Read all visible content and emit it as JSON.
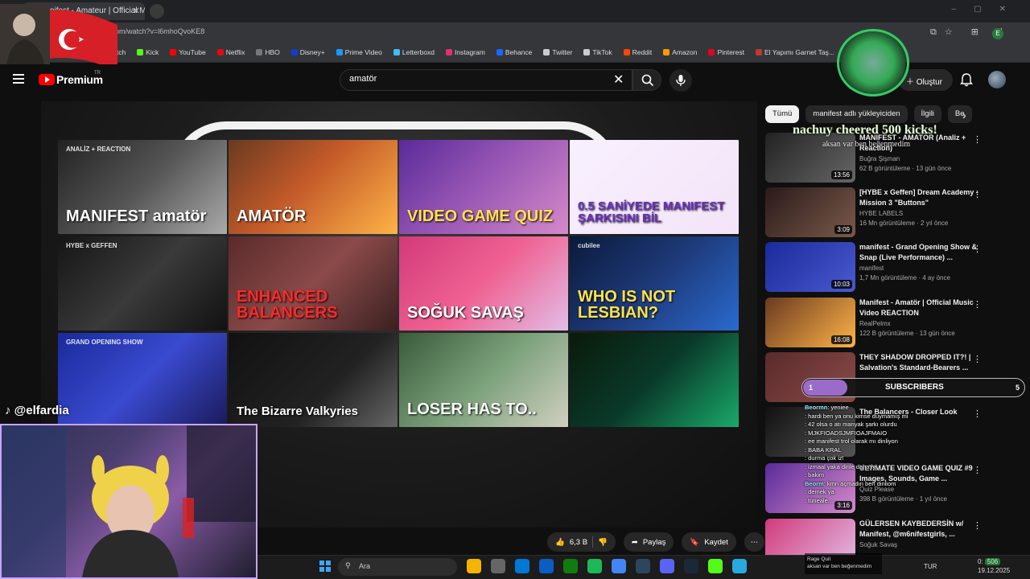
{
  "browser": {
    "tab_title": "nifest - Amateur | Official Mu",
    "url": ".com/watch?v=l6mhoQvoKE8",
    "bookmarks": [
      {
        "label": "itch",
        "color": "#9146ff"
      },
      {
        "label": "Kick",
        "color": "#53fc18"
      },
      {
        "label": "YouTube",
        "color": "#ff0000"
      },
      {
        "label": "Netflix",
        "color": "#e50914"
      },
      {
        "label": "HBO",
        "color": "#777777"
      },
      {
        "label": "Disney+",
        "color": "#113ccf"
      },
      {
        "label": "Prime Video",
        "color": "#1a98ff"
      },
      {
        "label": "Letterboxd",
        "color": "#40bcf4"
      },
      {
        "label": "Instagram",
        "color": "#e1306c"
      },
      {
        "label": "Behance",
        "color": "#1769ff"
      },
      {
        "label": "Twitter",
        "color": "#cccccc"
      },
      {
        "label": "TikTok",
        "color": "#cccccc"
      },
      {
        "label": "Reddit",
        "color": "#ff4500"
      },
      {
        "label": "Amazon",
        "color": "#ff9900"
      },
      {
        "label": "Pinterest",
        "color": "#e60023"
      },
      {
        "label": "El Yapımı Garnet Taş...",
        "color": "#c0392b"
      }
    ],
    "profile_initial": "E"
  },
  "youtube": {
    "premium_label": "Premium",
    "premium_region": "TR",
    "search_value": "amatör",
    "create_label": "Oluştur"
  },
  "player": {
    "thumbs": [
      {
        "text": "MANIFEST amatör",
        "sub": "ANALİZ + REACTION",
        "bg": "linear-gradient(135deg,#222,#555 50%,#aaa)",
        "color": "#fff"
      },
      {
        "text": "AMATÖR",
        "sub": "",
        "bg": "linear-gradient(135deg,#6a3a20,#c35a2a 45%,#ffb347)",
        "color": "#fff"
      },
      {
        "text": "VIDEO GAME QUIZ",
        "sub": "",
        "bg": "linear-gradient(135deg,#5a2a9a,#9b59b6 50%,#d58ac8)",
        "color": "#ffe34a"
      },
      {
        "text": "0.5 SANİYEDE MANIFEST ŞARKISINI BİL",
        "sub": "",
        "bg": "linear-gradient(135deg,#f8f0ff,#f3e4f7)",
        "color": "#6a2fc0"
      },
      {
        "text": "",
        "sub": "HYBE x GEFFEN",
        "bg": "linear-gradient(135deg,#151515,#3a3a3a 50%,#111)",
        "color": "#fff"
      },
      {
        "text": "ENHANCED BALANCERS",
        "sub": "",
        "bg": "linear-gradient(135deg,#5a2a2a,#8b4a4a 50%,#3a2020)",
        "color": "#ff2a2a"
      },
      {
        "text": "SOĞUK SAVAŞ",
        "sub": "",
        "bg": "linear-gradient(135deg,#d23a7a,#f06292 50%,#e1bee7)",
        "color": "#fff"
      },
      {
        "text": "WHO IS NOT LESBIAN?",
        "sub": "cubilee",
        "bg": "linear-gradient(135deg,#0a1a3a,#1e3a7a 50%,#2a6ad0)",
        "color": "#ffe34a"
      },
      {
        "text": "",
        "sub": "GRAND OPENING SHOW",
        "bg": "linear-gradient(135deg,#1a2a9a,#3a4ad0 50%,#1a1a5a)",
        "color": "#fff"
      },
      {
        "text": "The Bizarre Valkyries",
        "sub": "",
        "bg": "linear-gradient(135deg,#111,#222 60%,#666)",
        "color": "#fff"
      },
      {
        "text": "LOSER HAS TO..",
        "sub": "",
        "bg": "linear-gradient(135deg,#3a5a3a,#7aa07a 50%,#d0d0c0)",
        "color": "#fff"
      },
      {
        "text": "",
        "sub": "",
        "bg": "linear-gradient(135deg,#0a1a0a,#0a3a2a 50%,#1aaa6a)",
        "color": "#fff"
      }
    ],
    "likes": "6,3 B",
    "share_label": "Paylaş",
    "save_label": "Kaydet"
  },
  "sidebar": {
    "chips": [
      "Tümü",
      "manifest adlı yükleyiciden",
      "İlgili",
      "Be"
    ],
    "videos": [
      {
        "title": "MANIFEST - AMATÖR (Analiz + Reaction)",
        "channel": "Buğra Şişman",
        "meta": "62 B görüntüleme · 13 gün önce",
        "duration": "13:56",
        "bg": "linear-gradient(135deg,#222,#666)"
      },
      {
        "title": "[HYBE x Geffen] Dream Academy - Mission 3 \"Buttons\"",
        "channel": "HYBE LABELS",
        "meta": "16 Mn görüntüleme · 2 yıl önce",
        "duration": "3:09",
        "bg": "linear-gradient(135deg,#2a1a1a,#7a5a4a)"
      },
      {
        "title": "manifest - Grand Opening Show & Snap (Live Performance) ...",
        "channel": "manifest",
        "meta": "1,7 Mn görüntüleme · 4 ay önce",
        "duration": "10:03",
        "bg": "linear-gradient(135deg,#1a2a9a,#4a5ad0)"
      },
      {
        "title": "Manifest - Amatör | Official Music Video REACTION",
        "channel": "RealPelmx",
        "meta": "122 B görüntüleme · 13 gün önce",
        "duration": "16:08",
        "bg": "linear-gradient(135deg,#6a3a20,#ffb347)"
      },
      {
        "title": "THEY SHADOW DROPPED IT?! | Salvation's Standard-Bearers ...",
        "channel": "",
        "meta": "",
        "duration": "",
        "bg": "linear-gradient(135deg,#5a2a2a,#8b4a4a)"
      },
      {
        "title": "The Balancers - Closer Look",
        "channel": "",
        "meta": "",
        "duration": "",
        "bg": "linear-gradient(135deg,#111,#555)"
      },
      {
        "title": "ULTIMATE VIDEO GAME QUIZ #9 Images, Sounds, Game ...",
        "channel": "Quiz Please",
        "meta": "398 B görüntüleme · 1 yıl önce",
        "duration": "3:16",
        "bg": "linear-gradient(135deg,#5a2a9a,#d58ac8)"
      },
      {
        "title": "GÜLERSEN KAYBEDERSİN w/ Manifest, @m6nifestgirls, ...",
        "channel": "Soğuk Savaş",
        "meta": "",
        "duration": "",
        "bg": "linear-gradient(135deg,#d23a7a,#e1bee7)"
      }
    ]
  },
  "overlay": {
    "kick_alert": "nachuy cheered 500 kicks!",
    "kick_alert_sub": "aksan var ben beğenmedim",
    "sub_count": "1",
    "sub_label": "SUBSCRIBERS",
    "sub_goal": "5",
    "sub_progress": 0.2,
    "streamer_handle": "@elfardia",
    "chat": [
      {
        "user": "Beormn",
        "msg": ": yeniee"
      },
      {
        "user": "",
        "msg": ": hardi ben ya onu kimse duymamış mi"
      },
      {
        "user": "",
        "msg": ": 42 olsa o atı manyak şarkı olurdu"
      },
      {
        "user": "",
        "msg": ": MJKFIOADSJMFIOAJFMAIO"
      },
      {
        "user": "",
        "msg": ": ee manifest trol olarak mı dinliyon"
      },
      {
        "user": "",
        "msg": ": BABA KRAL"
      },
      {
        "user": "",
        "msg": ": durma çok iz!"
      },
      {
        "user": "",
        "msg": ": izmaal yaka dinle daha iyi"
      },
      {
        "user": "",
        "msg": ": bakim"
      },
      {
        "user": "Beorm",
        "msg": ": kmn açmadın ben dinliom"
      },
      {
        "user": "",
        "msg": ": demek ya"
      },
      {
        "user": "",
        "msg": ": tüneale..."
      }
    ],
    "kick_chat_title": "Rage Quit",
    "kick_chat_msg": "aksan var ben beğenmedim"
  },
  "taskbar": {
    "search_label": "Ara",
    "lang": "TUR",
    "time": "0:",
    "date": "19.12.2025",
    "badge": "506",
    "apps": [
      "#f4b400",
      "#666666",
      "#0078d4",
      "#0a5dc2",
      "#107c10",
      "#1db954",
      "#4285f4",
      "#2a475e",
      "#5865f2",
      "#1b2838",
      "#53fc18",
      "#2aa8e0"
    ]
  }
}
